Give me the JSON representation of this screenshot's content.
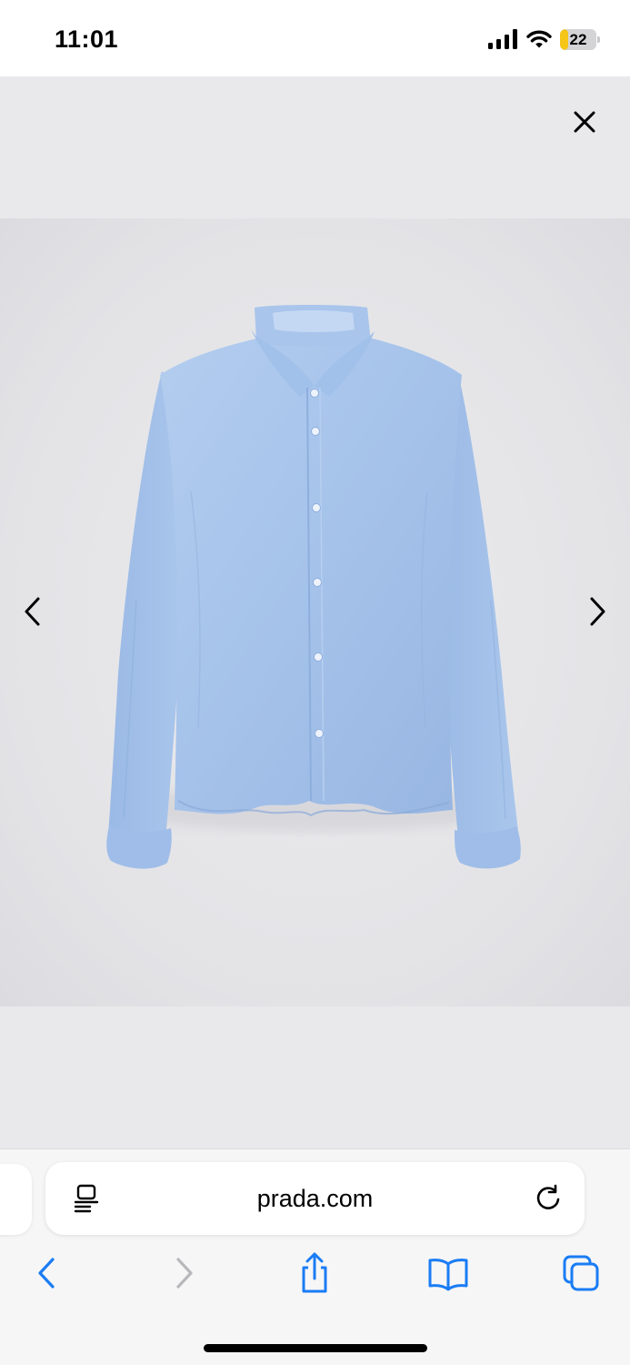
{
  "status_bar": {
    "time": "11:01",
    "battery_level": "22",
    "battery_fraction": 0.22,
    "battery_color": "#f5c518"
  },
  "gallery": {
    "close_icon": "close-icon",
    "prev_icon": "chevron-left-icon",
    "next_icon": "chevron-right-icon",
    "image": "product-photo-blue-shirt",
    "shirt_color": "#a7c4ea"
  },
  "browser": {
    "url": "prada.com",
    "page_menu_icon": "page-menu-icon",
    "reload_icon": "reload-icon",
    "accent_color": "#1a7cf4",
    "toolbar": {
      "back_icon": "back-icon",
      "forward_icon": "forward-icon",
      "share_icon": "share-icon",
      "bookmarks_icon": "bookmarks-icon",
      "tabs_icon": "tabs-icon"
    }
  }
}
